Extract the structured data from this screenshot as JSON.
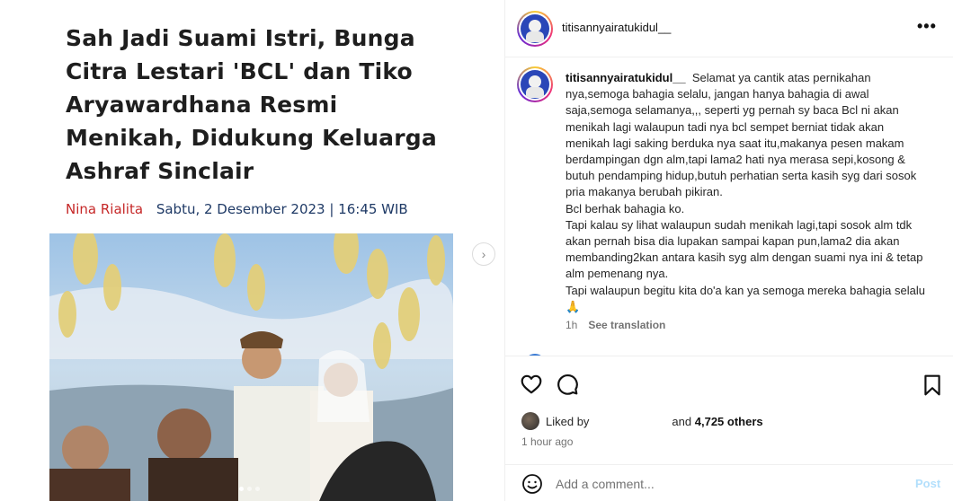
{
  "article": {
    "headline": "Sah Jadi Suami Istri, Bunga Citra Lestari 'BCL' dan Tiko Aryawardhana Resmi Menikah, Didukung Keluarga Ashraf Sinclair",
    "author": "Nina Rialita",
    "date": "Sabtu, 2 Desember 2023 | 16:45 WIB"
  },
  "carousel": {
    "next_icon": "chevron-right-icon",
    "dot_count": 3,
    "active_dot": 0
  },
  "post": {
    "username": "titisannyairatukidul__",
    "more_icon": "more-horizontal-icon"
  },
  "comment": {
    "username": "titisannyairatukidul__",
    "text": "Selamat ya cantik atas pernikahan nya,semoga bahagia selalu, jangan hanya bahagia di awal saja,semoga selamanya,,, seperti yg pernah sy baca Bcl ni akan menikah lagi walaupun tadi nya bcl sempet berniat tidak akan menikah lagi saking berduka nya saat itu,makanya pesen makam berdampingan dgn alm,tapi lama2 hati nya merasa sepi,kosong & butuh pendamping hidup,butuh perhatian serta kasih syg dari sosok pria makanya berubah pikiran.\nBcl berhak bahagia ko.\nTapi kalau sy lihat walaupun sudah menikah lagi,tapi sosok alm tdk akan pernah bisa dia lupakan sampai kapan pun,lama2 dia akan membanding2kan antara kasih syg alm dengan suami nya ini & tetap alm pemenang nya.\nTapi walaupun begitu kita do'a kan ya semoga mereka bahagia selalu🙏",
    "time": "1h",
    "translate_label": "See translation"
  },
  "actions": {
    "like_icon": "heart-icon",
    "comment_icon": "comment-icon",
    "save_icon": "bookmark-icon",
    "liked_by_label": "Liked by",
    "and_label": "and",
    "others_count": "4,725 others",
    "time_ago": "1 hour ago"
  },
  "composer": {
    "emoji_icon": "emoji-icon",
    "placeholder": "Add a comment...",
    "post_label": "Post"
  },
  "colors": {
    "author_red": "#c62828",
    "date_navy": "#1f3a66",
    "post_disabled_blue": "#b2dffc",
    "meta_gray": "#737373"
  }
}
